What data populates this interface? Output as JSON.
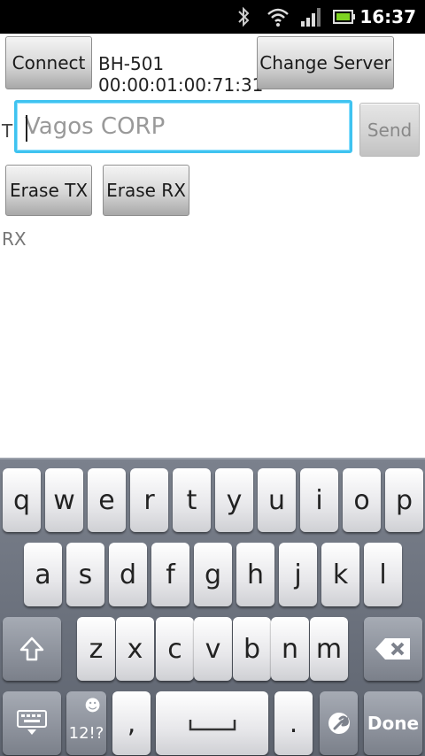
{
  "status_bar": {
    "time": "16:37",
    "icons": [
      "bluetooth-icon",
      "wifi-icon",
      "signal-icon",
      "battery-icon"
    ]
  },
  "toolbar": {
    "connect_label": "Connect",
    "device_name": "BH-501",
    "device_address": "00:00:01:00:71:31",
    "change_server_label": "Change Server"
  },
  "tx": {
    "label": "T",
    "input_value": "Vagos CORP",
    "send_label": "Send"
  },
  "erase": {
    "erase_tx_label": "Erase TX",
    "erase_rx_label": "Erase RX"
  },
  "rx": {
    "label": "RX"
  },
  "keyboard": {
    "row1": [
      "q",
      "w",
      "e",
      "r",
      "t",
      "y",
      "u",
      "i",
      "o",
      "p"
    ],
    "row2": [
      "a",
      "s",
      "d",
      "f",
      "g",
      "h",
      "j",
      "k",
      "l"
    ],
    "row3": [
      "z",
      "x",
      "c",
      "v",
      "b",
      "n",
      "m"
    ],
    "symbols_label": "12!?",
    "emoji_glyph": "☻",
    "comma": ",",
    "period": ".",
    "done_label": "Done"
  }
}
